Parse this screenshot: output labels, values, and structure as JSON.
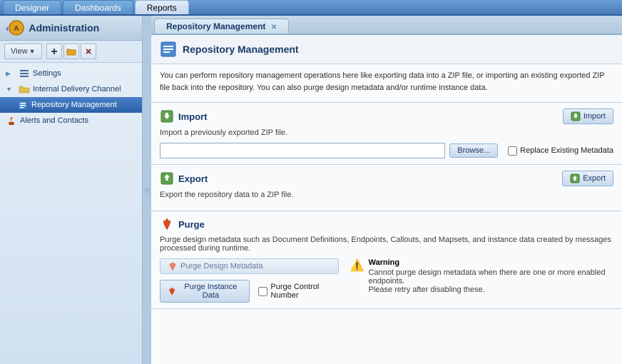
{
  "app": {
    "tabs": [
      {
        "label": "Designer",
        "active": false
      },
      {
        "label": "Dashboards",
        "active": false
      },
      {
        "label": "Reports",
        "active": true
      }
    ]
  },
  "sidebar": {
    "title": "Administration",
    "view_label": "View",
    "nav_items": [
      {
        "label": "Settings",
        "icon": "settings",
        "indent": 1,
        "expanded": true,
        "expandable": true
      },
      {
        "label": "Internal Delivery Channel",
        "icon": "folder",
        "indent": 1,
        "expanded": true,
        "expandable": true
      },
      {
        "label": "Repository Management",
        "icon": "repo",
        "indent": 2,
        "active": true
      },
      {
        "label": "Alerts and Contacts",
        "icon": "alerts",
        "indent": 1
      }
    ]
  },
  "content": {
    "tab_label": "Repository Management",
    "section_title": "Repository Management",
    "description": "You can perform repository management operations here like exporting data into a ZIP file, or importing an existing exported ZIP file back into the repository.  You can also purge design metadata and/or runtime instance data.",
    "import": {
      "section_title": "Import",
      "section_desc": "Import a previously exported ZIP file.",
      "btn_label": "Import",
      "file_input_value": "",
      "browse_label": "Browse...",
      "replace_label": "Replace Existing Metadata"
    },
    "export": {
      "section_title": "Export",
      "section_desc": "Export the repository data to a ZIP file.",
      "btn_label": "Export"
    },
    "purge": {
      "section_title": "Purge",
      "section_desc": "Purge design metadata such as Document Definitions, Endpoints, Callouts, and Mapsets, and instance data created by messages processed during runtime.",
      "purge_design_label": "Purge Design Metadata",
      "warning_title": "Warning",
      "warning_line1": "Cannot purge design metadata when there are one or more enabled endpoints.",
      "warning_line2": "Please retry after disabling these.",
      "purge_instance_label": "Purge Instance Data",
      "purge_control_label": "Purge Control Number"
    }
  }
}
